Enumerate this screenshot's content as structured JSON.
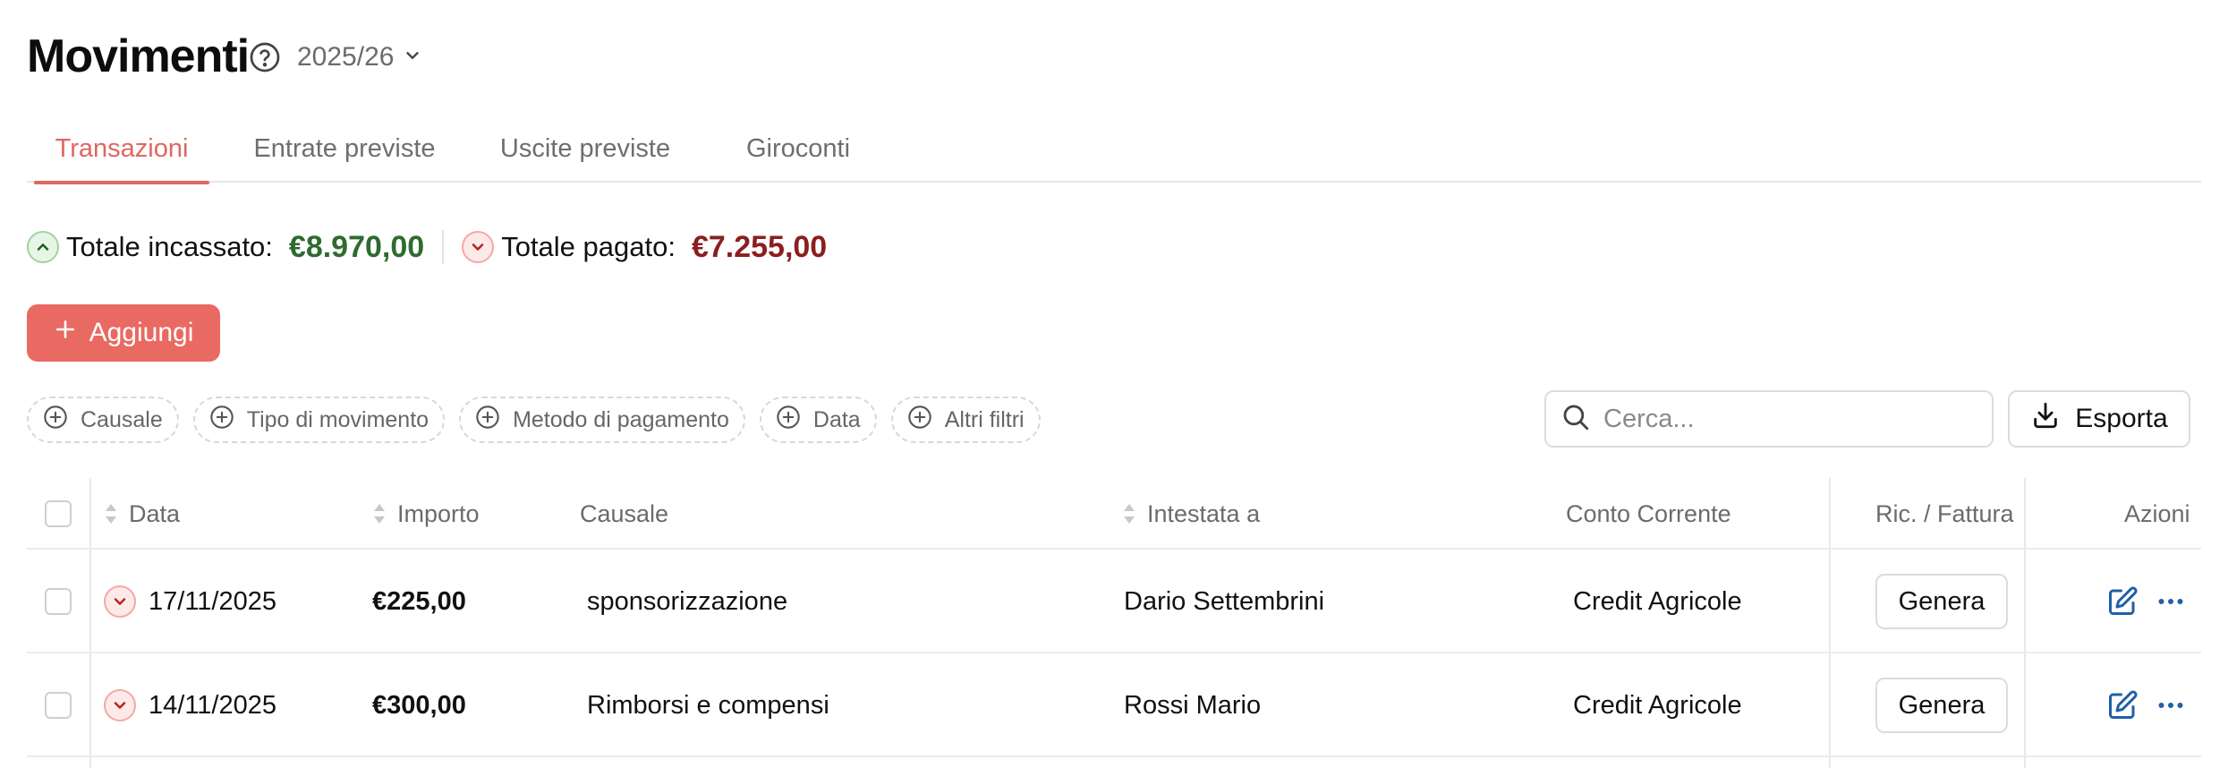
{
  "page": {
    "title": "Movimenti",
    "year_selector": "2025/26"
  },
  "tabs": [
    {
      "label": "Transazioni",
      "active": true
    },
    {
      "label": "Entrate previste",
      "active": false
    },
    {
      "label": "Uscite previste",
      "active": false
    },
    {
      "label": "Giroconti",
      "active": false
    }
  ],
  "totals": {
    "incassato_label": "Totale incassato:",
    "incassato_value": "€8.970,00",
    "pagato_label": "Totale pagato:",
    "pagato_value": "€7.255,00"
  },
  "actions": {
    "add_label": "Aggiungi",
    "export_label": "Esporta"
  },
  "filters": [
    "Causale",
    "Tipo di movimento",
    "Metodo di pagamento",
    "Data",
    "Altri filtri"
  ],
  "search": {
    "placeholder": "Cerca..."
  },
  "table": {
    "headers": {
      "data": "Data",
      "importo": "Importo",
      "causale": "Causale",
      "intestata": "Intestata a",
      "conto": "Conto Corrente",
      "ricevuta": "Ric. / Fattura",
      "azioni": "Azioni"
    },
    "rows": [
      {
        "direction": "uscita",
        "data": "17/11/2025",
        "importo": "€225,00",
        "causale": "sponsorizzazione",
        "intestata": "Dario Settembrini",
        "conto": "Credit Agricole",
        "ricevuta": "Genera"
      },
      {
        "direction": "uscita",
        "data": "14/11/2025",
        "importo": "€300,00",
        "causale": "Rimborsi e compensi",
        "intestata": "Rossi Mario",
        "conto": "Credit Agricole",
        "ricevuta": "Genera"
      }
    ]
  },
  "colors": {
    "accent": "#e96a62",
    "positive": "#2e6b2f",
    "negative": "#8b1e1e",
    "action_blue": "#1f5fa8"
  },
  "icons": [
    "help-circle-icon",
    "chevron-down-icon",
    "arrow-up-circle-icon",
    "arrow-down-circle-icon",
    "plus-icon",
    "plus-circle-icon",
    "search-icon",
    "download-icon",
    "sort-icon",
    "edit-icon",
    "more-horizontal-icon"
  ]
}
